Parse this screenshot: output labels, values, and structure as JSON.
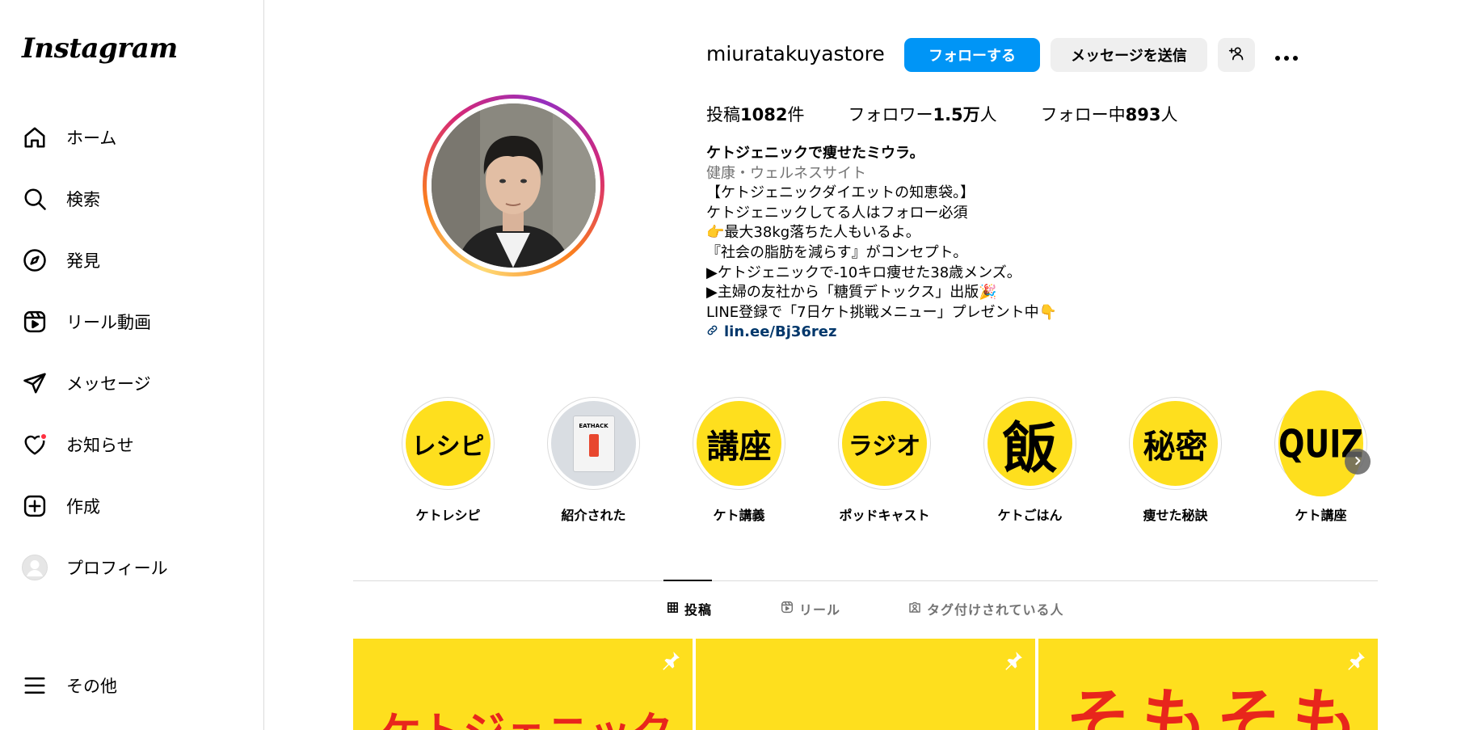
{
  "app": {
    "logo": "Instagram"
  },
  "sidebar": {
    "items": [
      {
        "label": "ホーム",
        "icon": "home-icon"
      },
      {
        "label": "検索",
        "icon": "search-icon"
      },
      {
        "label": "発見",
        "icon": "explore-compass-icon"
      },
      {
        "label": "リール動画",
        "icon": "reels-icon"
      },
      {
        "label": "メッセージ",
        "icon": "messages-paper-plane-icon"
      },
      {
        "label": "お知らせ",
        "icon": "heart-icon"
      },
      {
        "label": "作成",
        "icon": "create-plus-icon"
      },
      {
        "label": "プロフィール",
        "icon": "profile-avatar-icon"
      }
    ],
    "more": {
      "label": "その他",
      "icon": "hamburger-menu-icon"
    }
  },
  "profile": {
    "username": "miuratakuyastore",
    "follow_label": "フォローする",
    "message_label": "メッセージを送信",
    "stats": {
      "posts_prefix": "投稿",
      "posts_value": "1082",
      "posts_suffix": "件",
      "followers_prefix": "フォロワー",
      "followers_value": "1.5万",
      "followers_suffix": "人",
      "following_prefix": "フォロー中",
      "following_value": "893",
      "following_suffix": "人"
    },
    "bio": {
      "name": "ケトジェニックで痩せたミウラ。",
      "category": "健康・ウェルネスサイト",
      "lines": [
        "【ケトジェニックダイエットの知恵袋。】",
        "ケトジェニックしてる人はフォロー必須",
        "👉最大38kg落ちた人もいるよ。",
        "『社会の脂肪を減らす』がコンセプト。",
        "▶︎ケトジェニックで-10キロ痩せた38歳メンズ。",
        "▶︎主婦の友社から「糖質デトックス」出版🎉",
        "LINE登録で「7日ケト挑戦メニュー」プレゼント中👇"
      ],
      "link": "lin.ee/Bj36rez"
    }
  },
  "highlights": [
    {
      "cover_text": "レシピ",
      "caption": "ケトレシピ"
    },
    {
      "cover_text": "EATHACK",
      "caption": "紹介された"
    },
    {
      "cover_text": "講座",
      "caption": "ケト講義"
    },
    {
      "cover_text": "ラジオ",
      "caption": "ポッドキャスト"
    },
    {
      "cover_text": "飯",
      "caption": "ケトごはん"
    },
    {
      "cover_text": "秘密",
      "caption": "痩せた秘訣"
    },
    {
      "cover_text": "QUIZ",
      "caption": "ケト講座"
    }
  ],
  "tabs": [
    {
      "label": "投稿",
      "icon": "grid-icon",
      "active": true
    },
    {
      "label": "リール",
      "icon": "reels-icon",
      "active": false
    },
    {
      "label": "タグ付けされている人",
      "icon": "tagged-person-icon",
      "active": false
    }
  ],
  "posts": [
    {
      "text": "ケトジェニック",
      "pinned": true
    },
    {
      "text": "",
      "pinned": true
    },
    {
      "text": "そもそも",
      "pinned": true
    }
  ],
  "colors": {
    "accent": "#0095f6",
    "highlight_yellow": "#fedf1e",
    "post_text_red": "#e8261c",
    "link": "#00376b"
  }
}
